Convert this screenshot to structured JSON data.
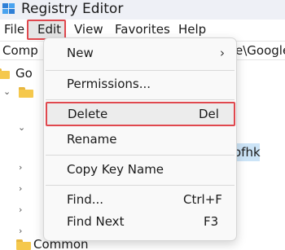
{
  "window": {
    "title": "Registry Editor",
    "app_icon": "registry-editor-icon"
  },
  "menubar": {
    "items": [
      {
        "label": "File"
      },
      {
        "label": "Edit"
      },
      {
        "label": "View"
      },
      {
        "label": "Favorites"
      },
      {
        "label": "Help"
      }
    ]
  },
  "address": {
    "left_text": "Comp",
    "right_text": "e\\Google"
  },
  "tree": {
    "items": [
      {
        "label": "Go"
      },
      {
        "label": "ofhk"
      },
      {
        "label": "Common"
      }
    ]
  },
  "edit_menu": {
    "items": [
      {
        "label": "New",
        "shortcut": "",
        "submenu": true
      },
      {
        "label": "Permissions...",
        "shortcut": ""
      },
      {
        "label": "Delete",
        "shortcut": "Del",
        "highlighted": true
      },
      {
        "label": "Rename",
        "shortcut": ""
      },
      {
        "label": "Copy Key Name",
        "shortcut": ""
      },
      {
        "label": "Find...",
        "shortcut": "Ctrl+F"
      },
      {
        "label": "Find Next",
        "shortcut": "F3"
      }
    ]
  },
  "colors": {
    "highlight_border": "#e0484e",
    "folder": "#f5c84c",
    "selection": "#cce4f7"
  }
}
